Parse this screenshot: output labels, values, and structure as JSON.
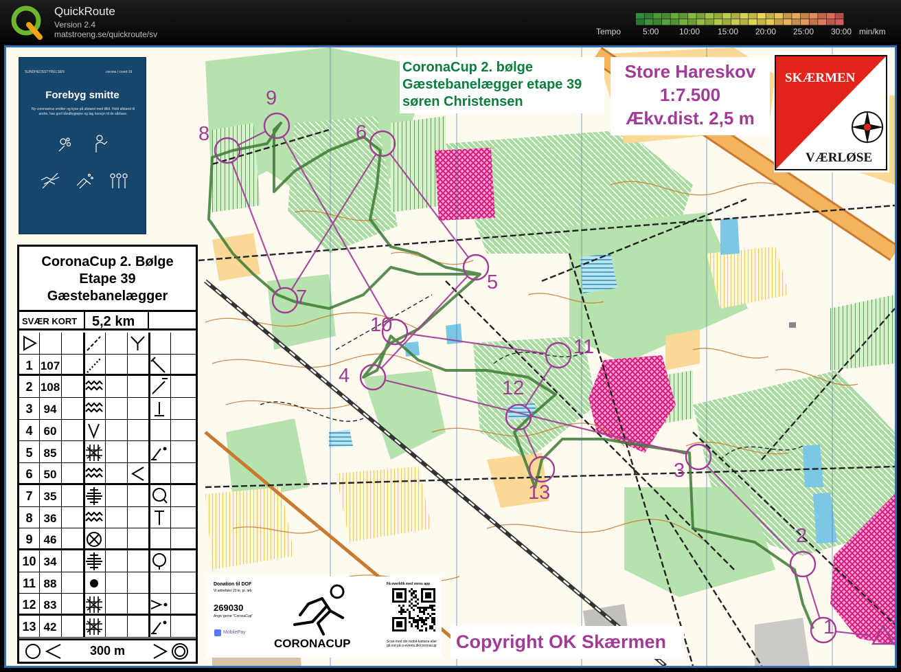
{
  "app": {
    "name": "QuickRoute",
    "version": "Version 2.4",
    "url": "matstroeng.se/quickroute/sv"
  },
  "tempo": {
    "label": "Tempo",
    "ticks": [
      "5:00",
      "10:00",
      "15:00",
      "20:00",
      "25:00",
      "30:00"
    ],
    "unit": "min/km",
    "colors": [
      "#2e8b3a",
      "#6fae3e",
      "#b6c84a",
      "#e8d856",
      "#e8a35a",
      "#d65a5a"
    ]
  },
  "poster": {
    "org": "SUNDHEDSSTYRELSEN",
    "tag": "corona | covid-19",
    "title": "Forebyg smitte",
    "body": "Ny coronavirus smitter og kyse på afstand med tillid. Hold afstand til andre, hav god håndhygiejne og tag hensyn til de sårbare.",
    "icons": [
      "hand-wash-icon",
      "cough-elbow-icon",
      "no-handshake-icon",
      "disinfect-icon",
      "distance-icon"
    ]
  },
  "control_description": {
    "title_lines": [
      "CoronaCup 2. Bølge",
      "Etape 39",
      "Gæstebanelægger"
    ],
    "class": "SVÆR KORT",
    "length": "5,2 km",
    "controls": [
      {
        "num": "1",
        "code": "107",
        "feature": "vegetation-boundary",
        "detail": "corner-ne"
      },
      {
        "num": "2",
        "code": "108",
        "feature": "thicket",
        "detail": "corner-sw"
      },
      {
        "num": "3",
        "code": "94",
        "feature": "thicket",
        "detail": "foot"
      },
      {
        "num": "4",
        "code": "60",
        "feature": "re-entrant",
        "detail": ""
      },
      {
        "num": "5",
        "code": "85",
        "feature": "marsh",
        "detail": "corner-sw-dot"
      },
      {
        "num": "6",
        "code": "50",
        "feature": "thicket",
        "extra": "angle",
        "detail": ""
      },
      {
        "num": "7",
        "code": "35",
        "feature": "marsh-lines",
        "detail": "q-circle"
      },
      {
        "num": "8",
        "code": "36",
        "feature": "thicket",
        "detail": "top"
      },
      {
        "num": "9",
        "code": "46",
        "feature": "crossed-circle",
        "detail": ""
      },
      {
        "num": "10",
        "code": "34",
        "feature": "marsh-lines",
        "detail": "q-circle-bottom"
      },
      {
        "num": "11",
        "code": "88",
        "feature": "dot",
        "detail": ""
      },
      {
        "num": "12",
        "code": "83",
        "feature": "marsh",
        "detail": "arrow-dot"
      },
      {
        "num": "13",
        "code": "42",
        "feature": "marsh",
        "detail": "corner-sw-dot"
      }
    ],
    "finish_distance": "300 m"
  },
  "event_box": [
    "CoronaCup 2. bølge",
    "Gæstebanelægger etape 39",
    "søren Christensen"
  ],
  "area_box": [
    "Store Hareskov",
    "1:7.500",
    "Ækv.dist. 2,5 m"
  ],
  "club": {
    "top": "SKÆRMEN",
    "bottom": "VÆRLØSE"
  },
  "donation": {
    "title": "Donation til DOF",
    "sub": "Vi anbefaler 20 kr. pr. løb",
    "number": "269030",
    "note": "Angiv gerne \"CoronaCup\"",
    "pay": "MobilePay",
    "brand": "CORONACUP",
    "app": "Få overblik med vores app",
    "link": "Scan med din mobil-kamera eller gå ind på o-events.dk/coronacup"
  },
  "copyright": "Copyright OK Skærmen",
  "course": {
    "controls": [
      {
        "label": "1"
      },
      {
        "label": "2"
      },
      {
        "label": "3"
      },
      {
        "label": "4"
      },
      {
        "label": "5"
      },
      {
        "label": "6"
      },
      {
        "label": "7"
      },
      {
        "label": "8"
      },
      {
        "label": "9"
      },
      {
        "label": "10"
      },
      {
        "label": "11"
      },
      {
        "label": "12"
      },
      {
        "label": "13"
      }
    ],
    "color": "#a03c96"
  },
  "colors": {
    "map_frame": "#2f6fb3",
    "forest_green": "#8fd08c",
    "open_yellow": "#fbd896",
    "out_of_bounds": "#e0167f",
    "contour_brown": "#c8782a",
    "route": "#3c7a34"
  }
}
